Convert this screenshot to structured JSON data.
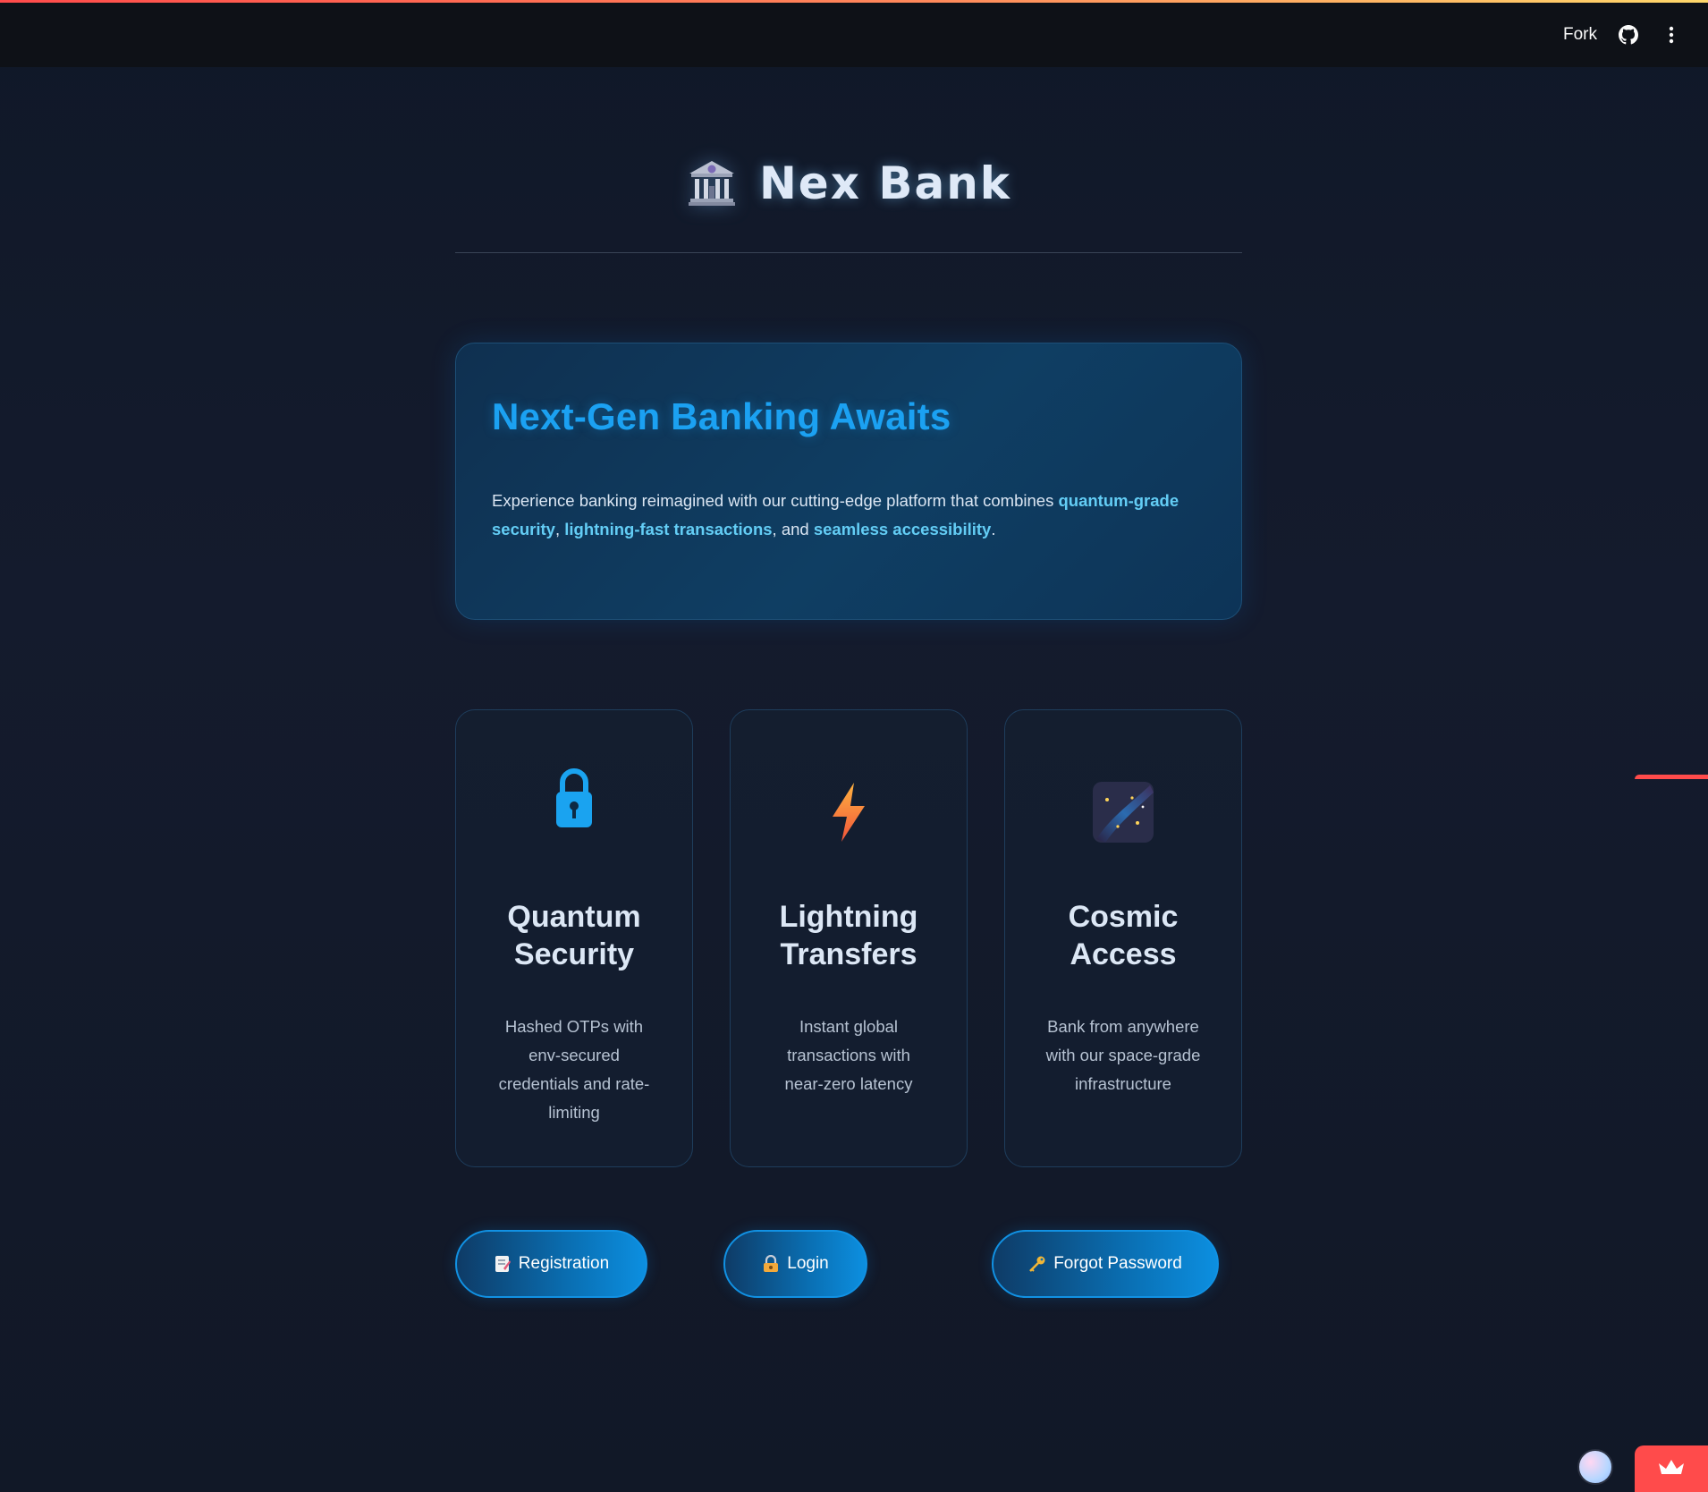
{
  "header": {
    "fork_label": "Fork",
    "github_icon": "github-icon",
    "menu_icon": "kebab-menu-icon"
  },
  "brand": {
    "title": "Nex Bank",
    "icon": "bank-building-icon"
  },
  "hero": {
    "heading": "Next-Gen Banking Awaits",
    "intro": "Experience banking reimagined with our cutting-edge platform that combines ",
    "highlight_1": "quantum-grade security",
    "sep_1": ", ",
    "highlight_2": "lightning-fast transactions",
    "sep_2": ", and ",
    "highlight_3": "seamless accessibility",
    "end": "."
  },
  "features": [
    {
      "icon": "lock-icon",
      "title": "Quantum Security",
      "desc": "Hashed OTPs with env-secured credentials and rate-limiting"
    },
    {
      "icon": "lightning-icon",
      "title": "Lightning Transfers",
      "desc": "Instant global transactions with near-zero latency"
    },
    {
      "icon": "milky-way-icon",
      "title": "Cosmic Access",
      "desc": "Bank from anywhere with our space-grade infrastructure"
    }
  ],
  "actions": {
    "register_label": "Registration",
    "login_label": "Login",
    "forgot_label": "Forgot Password"
  },
  "colors": {
    "accent": "#1ba1f2",
    "highlight": "#63cdf5",
    "streamlit_red": "#ff4b4b"
  }
}
